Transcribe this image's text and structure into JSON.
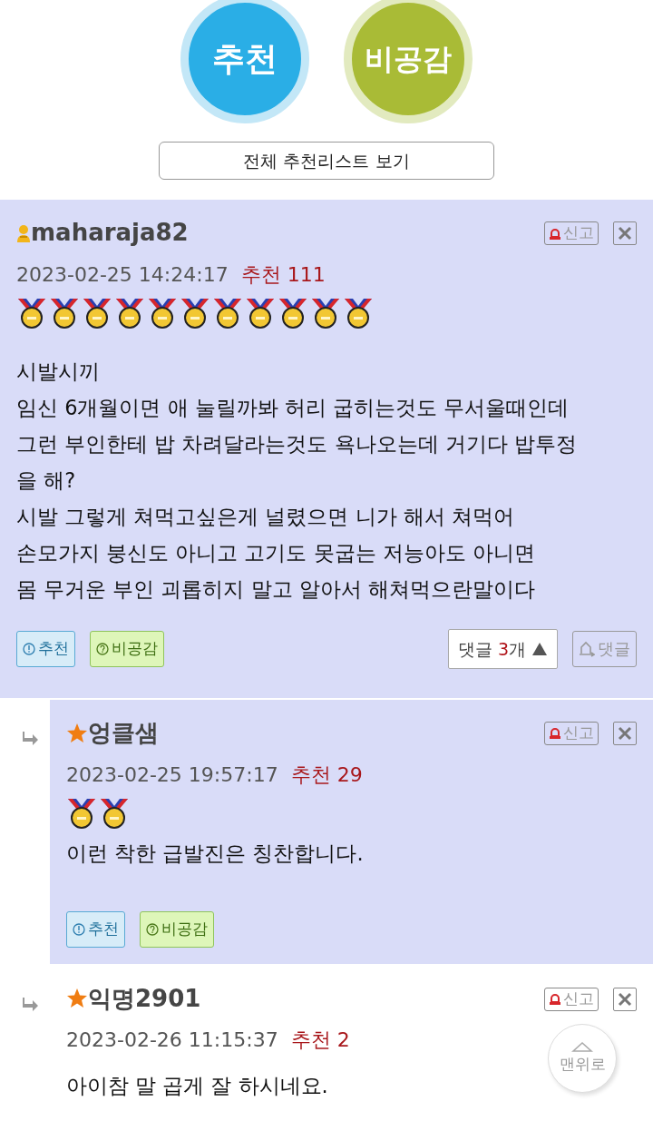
{
  "vote_buttons": [
    {
      "kind": "recommend",
      "label": "추천"
    },
    {
      "kind": "disagree",
      "label": "비공감"
    }
  ],
  "list_button": {
    "label": "전체 추천리스트 보기"
  },
  "comments": [
    {
      "kind": "best",
      "highlighted": true,
      "badge": {
        "kind": "person"
      },
      "username": "maharaja82",
      "date": "2023-02-25 14:24:17",
      "recommend": "추천 111",
      "medals": [
        {
          "kind": "medal"
        },
        {
          "kind": "medal"
        },
        {
          "kind": "medal"
        },
        {
          "kind": "medal"
        },
        {
          "kind": "medal"
        },
        {
          "kind": "medal"
        },
        {
          "kind": "medal"
        },
        {
          "kind": "medal"
        },
        {
          "kind": "medal"
        },
        {
          "kind": "medal"
        },
        {
          "kind": "medal"
        }
      ],
      "body": "시발시끼\n임신 6개월이면 애 눌릴까봐 허리 굽히는것도 무서울때인데\n그런 부인한테 밥 차려달라는것도 욕나오는데 거기다 밥투정\n을 해?\n시발 그렇게 쳐먹고싶은게 널렸으면 니가 해서 쳐먹어\n손모가지 붕신도 아니고 고기도 못굽는 저능아도 아니면\n몸 무거운 부인 괴롭히지 말고 알아서 해쳐먹으란말이다",
      "report": "신고",
      "actions": [
        {
          "kind": "recommend",
          "label": "추천"
        },
        {
          "kind": "disagree",
          "label": "비공감"
        }
      ],
      "reply_toggle": {
        "label": "댓글",
        "count": "3",
        "unit": "개",
        "expanded": true
      },
      "reply_button": {
        "label": "댓글"
      }
    },
    {
      "kind": "reply",
      "highlighted": true,
      "badge": {
        "kind": "star"
      },
      "username": "엉클샘",
      "date": "2023-02-25 19:57:17",
      "recommend": "추천 29",
      "medals": [
        {
          "kind": "medal"
        },
        {
          "kind": "medal"
        }
      ],
      "body": "이런 착한 급발진은 칭찬합니다.",
      "report": "신고",
      "actions": [
        {
          "kind": "recommend",
          "label": "추천"
        },
        {
          "kind": "disagree",
          "label": "비공감"
        }
      ]
    },
    {
      "kind": "reply",
      "highlighted": false,
      "badge": {
        "kind": "star"
      },
      "username": "익명2901",
      "date": "2023-02-26 11:15:37",
      "recommend": "추천 2",
      "body": "아이참 말 곱게 잘 하시네요.",
      "report": "신고"
    }
  ],
  "scroll_top": {
    "label": "맨위로"
  }
}
